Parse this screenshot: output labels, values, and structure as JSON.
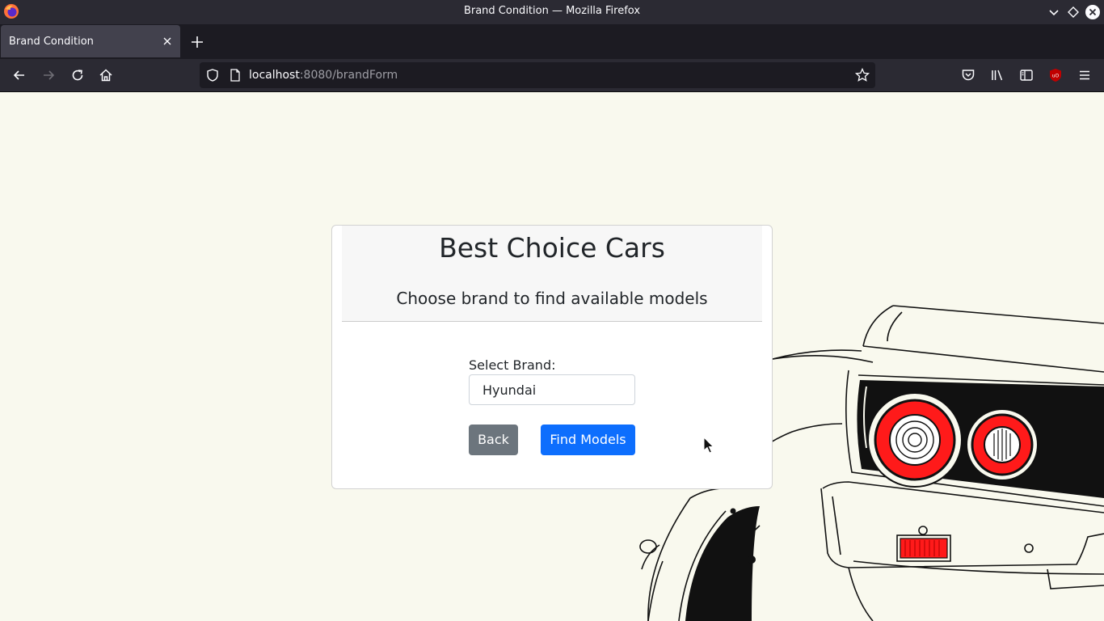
{
  "window": {
    "title": "Brand Condition — Mozilla Firefox"
  },
  "tabs": [
    {
      "label": "Brand Condition",
      "active": true
    }
  ],
  "navbar": {
    "url_host": "localhost",
    "url_path": ":8080/brandForm"
  },
  "card": {
    "title": "Best Choice Cars",
    "subtitle": "Choose brand to find available models",
    "brand_label": "Select Brand:",
    "brand_value": "Hyundai",
    "back_label": "Back",
    "find_label": "Find Models"
  },
  "colors": {
    "page_background": "#f9f9ee",
    "primary_button": "#0d6efd",
    "secondary_button": "#6c757d",
    "taillight_red": "#ff1a1a"
  },
  "icons": {
    "toolbar": [
      "back-icon",
      "forward-icon",
      "reload-icon",
      "home-icon"
    ],
    "urlbar": [
      "shield-icon",
      "page-icon",
      "bookmark-star-icon"
    ],
    "toolbar_right": [
      "pocket-icon",
      "library-icon",
      "sidebar-icon",
      "ublock-icon",
      "menu-icon"
    ]
  }
}
